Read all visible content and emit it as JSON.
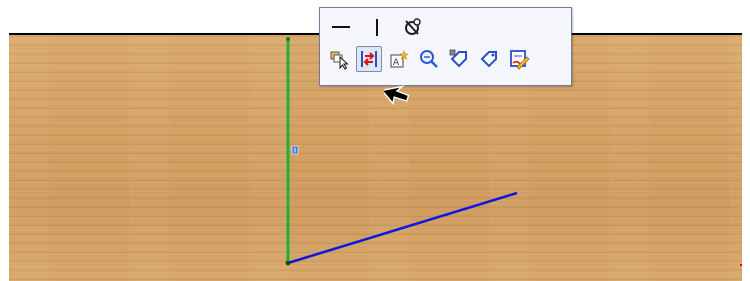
{
  "toolbar": {
    "row1": [
      "horizontal-line-icon",
      "vertical-line-icon",
      "fix-anchor-icon"
    ],
    "row2": [
      "select-other-icon",
      "add-relation-icon",
      "smart-dimension-icon",
      "zoom-to-selection-icon",
      "sketch-entity-icon",
      "tag-icon",
      "edit-sketch-icon"
    ],
    "active_item": "add-relation-icon"
  },
  "colors": {
    "construction_line": "#22b233",
    "sketch_line": "#0a18e0",
    "wood_background": "#d3a062",
    "accent_red": "#ff0000"
  }
}
